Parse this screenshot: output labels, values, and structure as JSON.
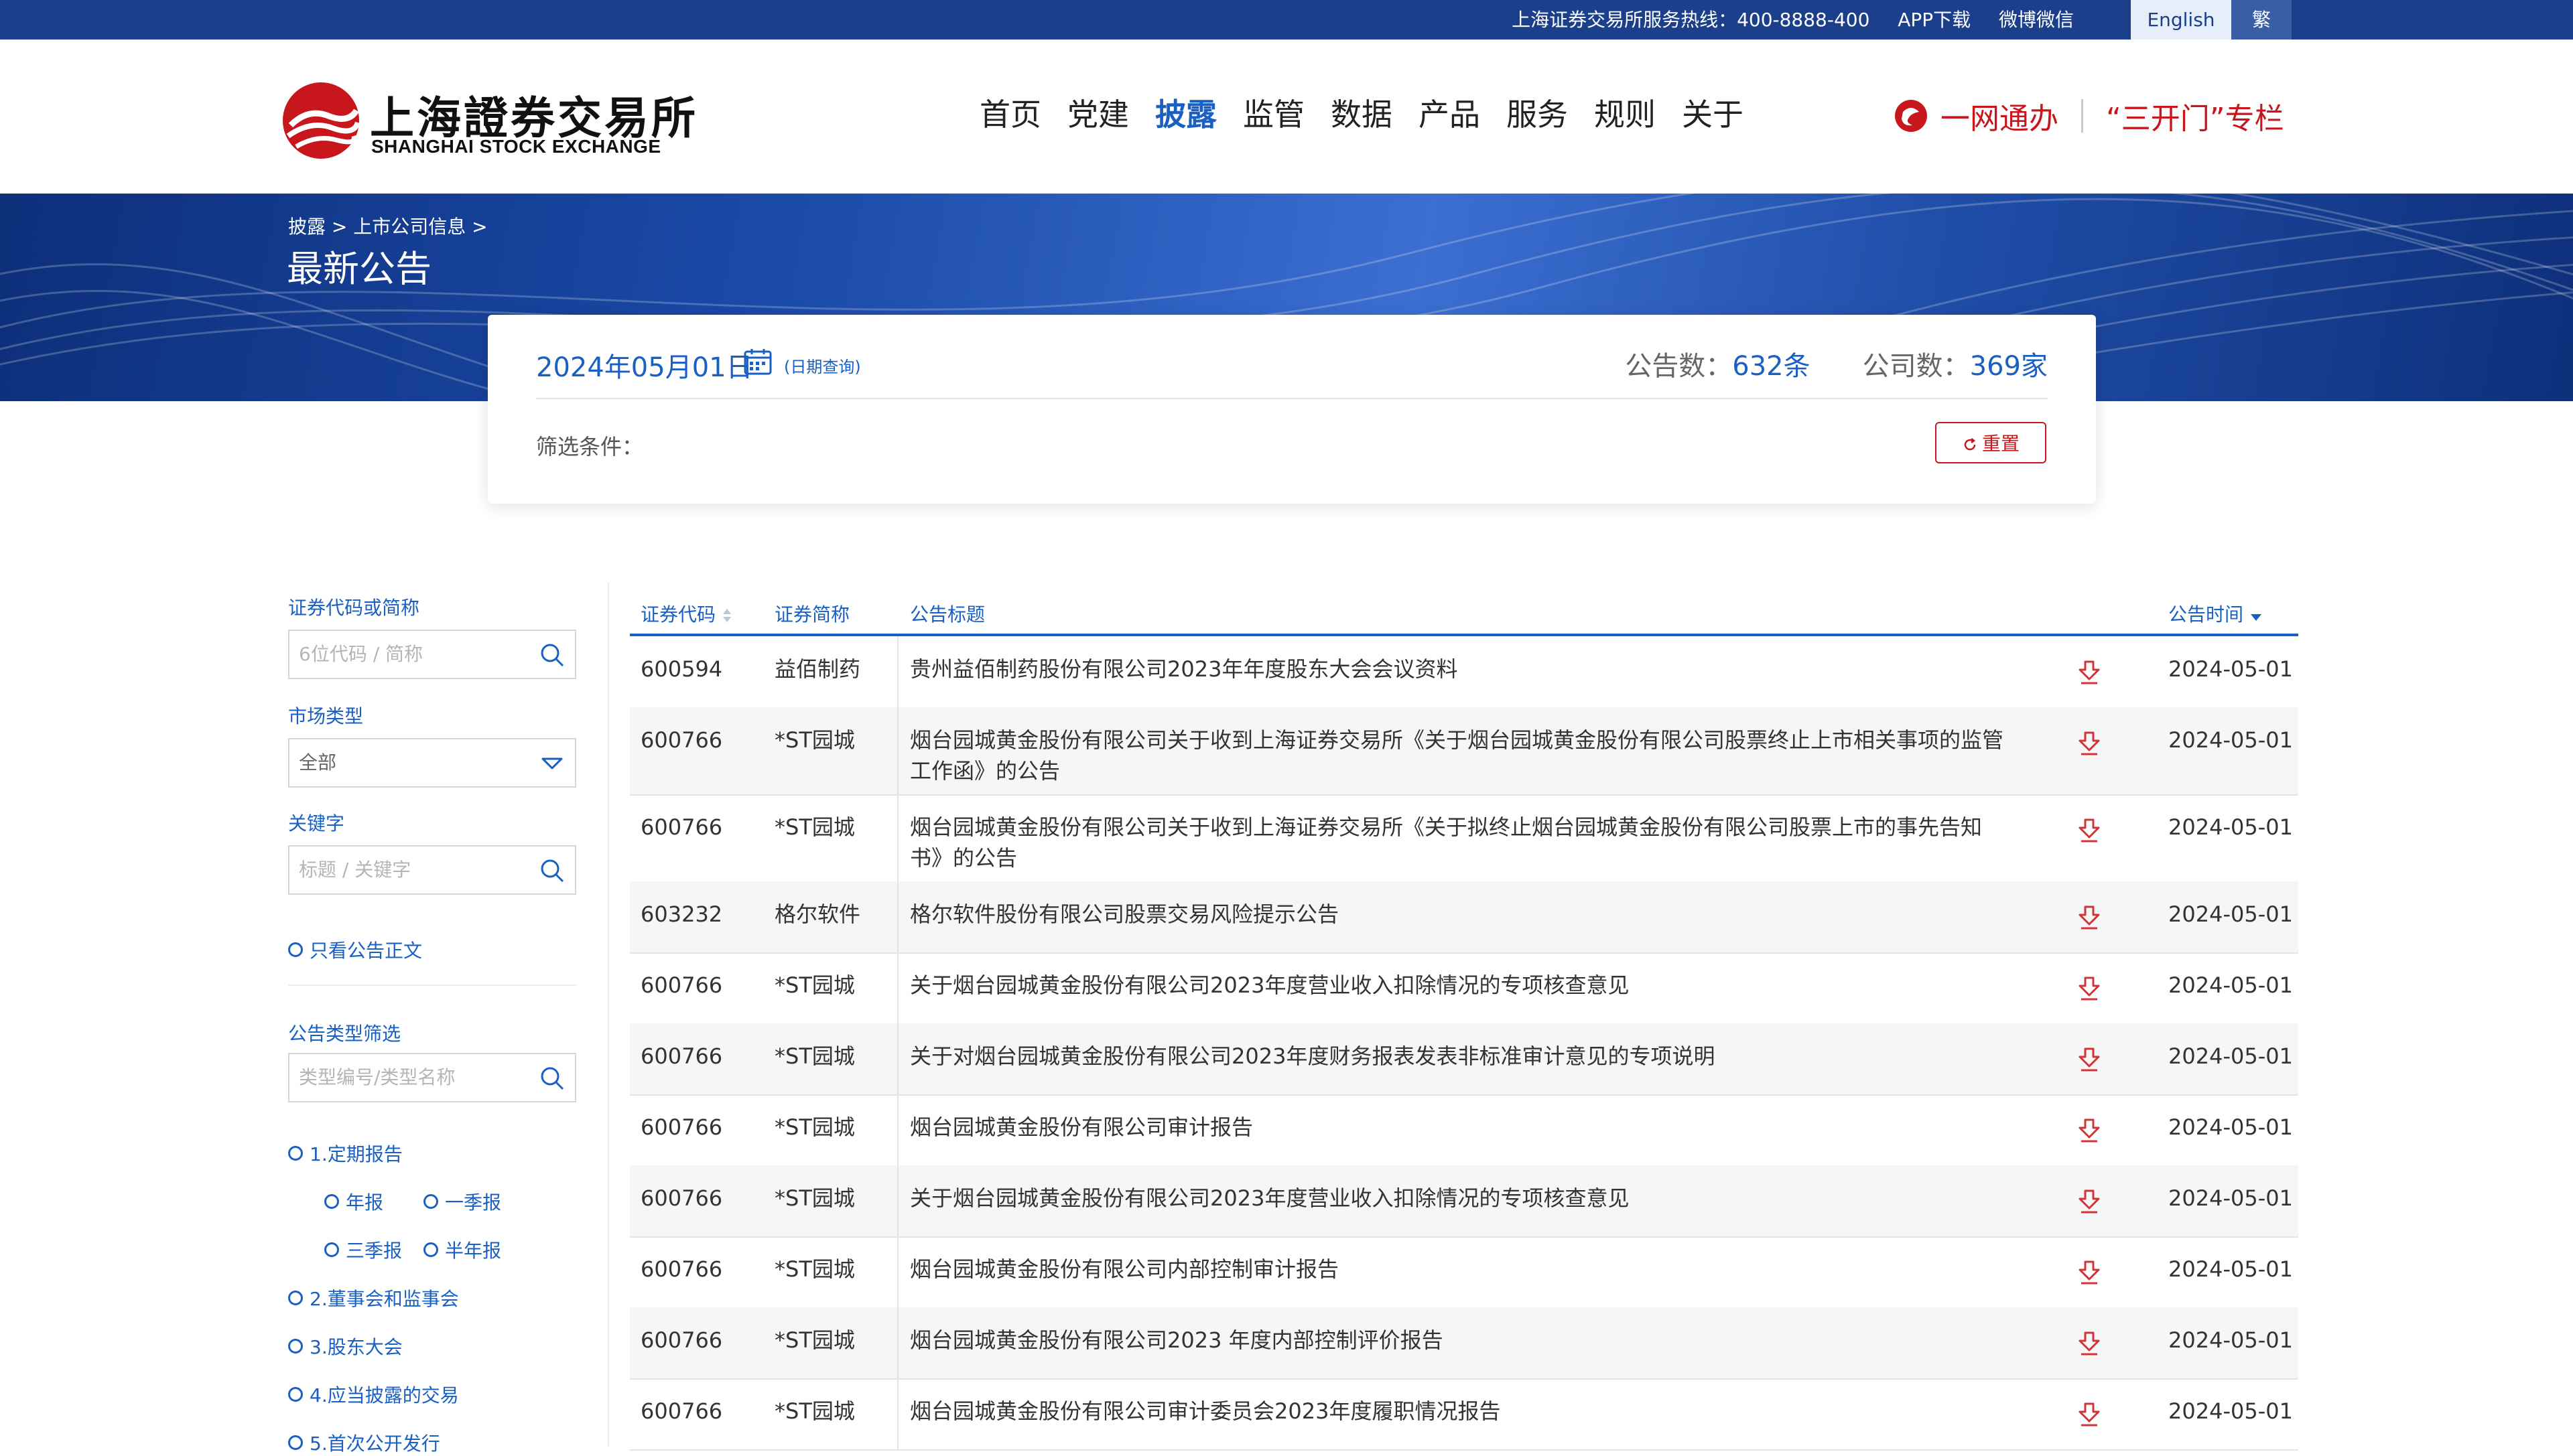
{
  "topbar": {
    "hotline": "上海证券交易所服务热线：400-8888-400",
    "app": "APP下载",
    "social": "微博微信",
    "lang_en": "English",
    "lang_tw": "繁"
  },
  "logo": {
    "cn": "上海證券交易所",
    "en": "SHANGHAI STOCK EXCHANGE"
  },
  "nav": {
    "items": [
      "首页",
      "党建",
      "披露",
      "监管",
      "数据",
      "产品",
      "服务",
      "规则",
      "关于"
    ],
    "active_index": 2
  },
  "header_links": {
    "yiwang": "一网通办",
    "sankaimen": "“三开门”专栏"
  },
  "banner": {
    "breadcrumb": "披露 > 上市公司信息 >",
    "title": "最新公告"
  },
  "summary": {
    "date": "2024年05月01日",
    "date_query": "(日期查询)",
    "notice_label": "公告数：",
    "notice_count": "632条",
    "company_label": "公司数：",
    "company_count": "369家",
    "filter_label": "筛选条件：",
    "reset_label": "重置"
  },
  "sidebar": {
    "code_label": "证券代码或简称",
    "code_placeholder": "6位代码 / 简称",
    "market_label": "市场类型",
    "market_value": "全部",
    "keyword_label": "关键字",
    "keyword_placeholder": "标题 / 关键字",
    "only_body": "只看公告正文",
    "type_filter_label": "公告类型筛选",
    "type_placeholder": "类型编号/类型名称",
    "types": {
      "t1": "1.定期报告",
      "annual": "年报",
      "q1": "一季报",
      "q3": "三季报",
      "half": "半年报",
      "t2": "2.董事会和监事会",
      "t3": "3.股东大会",
      "t4": "4.应当披露的交易",
      "t5": "5.首次公开发行"
    }
  },
  "table": {
    "headers": {
      "code": "证券代码",
      "name": "证券简称",
      "title": "公告标题",
      "time": "公告时间"
    },
    "rows": [
      {
        "code": "600594",
        "name": "益佰制药",
        "title": "贵州益佰制药股份有限公司2023年年度股东大会会议资料",
        "date": "2024-05-01"
      },
      {
        "code": "600766",
        "name": "*ST园城",
        "title": "烟台园城黄金股份有限公司关于收到上海证券交易所《关于烟台园城黄金股份有限公司股票终止上市相关事项的监管工作函》的公告",
        "date": "2024-05-01"
      },
      {
        "code": "600766",
        "name": "*ST园城",
        "title": "烟台园城黄金股份有限公司关于收到上海证券交易所《关于拟终止烟台园城黄金股份有限公司股票上市的事先告知书》的公告",
        "date": "2024-05-01"
      },
      {
        "code": "603232",
        "name": "格尔软件",
        "title": "格尔软件股份有限公司股票交易风险提示公告",
        "date": "2024-05-01"
      },
      {
        "code": "600766",
        "name": "*ST园城",
        "title": "关于烟台园城黄金股份有限公司2023年度营业收入扣除情况的专项核查意见",
        "date": "2024-05-01"
      },
      {
        "code": "600766",
        "name": "*ST园城",
        "title": "关于对烟台园城黄金股份有限公司2023年度财务报表发表非标准审计意见的专项说明",
        "date": "2024-05-01"
      },
      {
        "code": "600766",
        "name": "*ST园城",
        "title": "烟台园城黄金股份有限公司审计报告",
        "date": "2024-05-01"
      },
      {
        "code": "600766",
        "name": "*ST园城",
        "title": "关于烟台园城黄金股份有限公司2023年度营业收入扣除情况的专项核查意见",
        "date": "2024-05-01"
      },
      {
        "code": "600766",
        "name": "*ST园城",
        "title": "烟台园城黄金股份有限公司内部控制审计报告",
        "date": "2024-05-01"
      },
      {
        "code": "600766",
        "name": "*ST园城",
        "title": "烟台园城黄金股份有限公司2023 年度内部控制评价报告",
        "date": "2024-05-01"
      },
      {
        "code": "600766",
        "name": "*ST园城",
        "title": "烟台园城黄金股份有限公司审计委员会2023年度履职情况报告",
        "date": "2024-05-01"
      }
    ]
  },
  "colors": {
    "brand_blue": "#1a5fc2",
    "top_bar": "#1b3f8a",
    "red": "#c8161d"
  },
  "icons": [
    "search-icon",
    "chevron-down-icon",
    "calendar-icon",
    "refresh-icon",
    "download-icon",
    "yiwang-logo-icon",
    "sse-logo-icon",
    "sort-icon"
  ]
}
